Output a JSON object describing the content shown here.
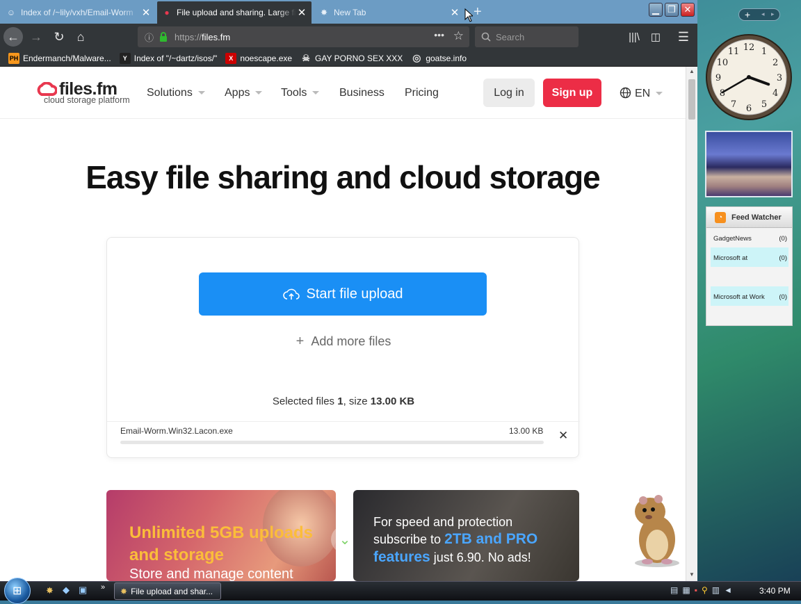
{
  "browser": {
    "tabs": [
      {
        "title": "Index of /~lily/vxh/Email-Worm",
        "active": false
      },
      {
        "title": "File upload and sharing. Large files",
        "active": true
      },
      {
        "title": "New Tab",
        "active": false
      }
    ],
    "url_scheme": "https://",
    "url_host": "files.fm",
    "search_placeholder": "Search",
    "bookmarks": [
      {
        "label": "Endermanch/Malware...",
        "icon": "PH"
      },
      {
        "label": "Index of \"/~dartz/isos/\"",
        "icon": "Y"
      },
      {
        "label": "noescape.exe",
        "icon": "X"
      },
      {
        "label": "GAY PORNO SEX XXX",
        "icon": "skull"
      },
      {
        "label": "goatse.info",
        "icon": "globe"
      }
    ]
  },
  "site": {
    "logo_name": "files.fm",
    "logo_tagline": "cloud storage platform",
    "nav": [
      "Solutions",
      "Apps",
      "Tools",
      "Business",
      "Pricing"
    ],
    "login": "Log in",
    "signup": "Sign up",
    "lang": "EN",
    "hero_title": "Easy file sharing and cloud storage",
    "upload": {
      "start_button": "Start file upload",
      "add_more": "Add more files",
      "selected_prefix": "Selected files ",
      "selected_count": "1",
      "selected_mid": ", size ",
      "selected_size": "13.00 KB",
      "file_name": "Email-Worm.Win32.Lacon.exe",
      "file_size": "13.00 KB",
      "progress": 0
    },
    "promo1": {
      "headline": "Unlimited 5GB uploads and storage",
      "sub": "Store and manage content"
    },
    "promo2": {
      "line1": "For speed and protection",
      "line2_prefix": "subscribe to ",
      "line2_highlight": "2TB and PRO",
      "line3_highlight": "features",
      "line3_suffix": " just 6.90. No ads!"
    }
  },
  "gadgets": {
    "clock": {
      "hour": 3,
      "minute": 40
    },
    "feed_title": "Feed Watcher",
    "feeds": [
      {
        "name": "GadgetNews",
        "count": "(0)"
      },
      {
        "name": "Microsoft at",
        "count": "(0)"
      },
      {
        "name": "Microsoft at Work",
        "count": "(0)"
      }
    ]
  },
  "taskbar": {
    "window_label": "File upload and shar...",
    "time": "3:40 PM"
  }
}
